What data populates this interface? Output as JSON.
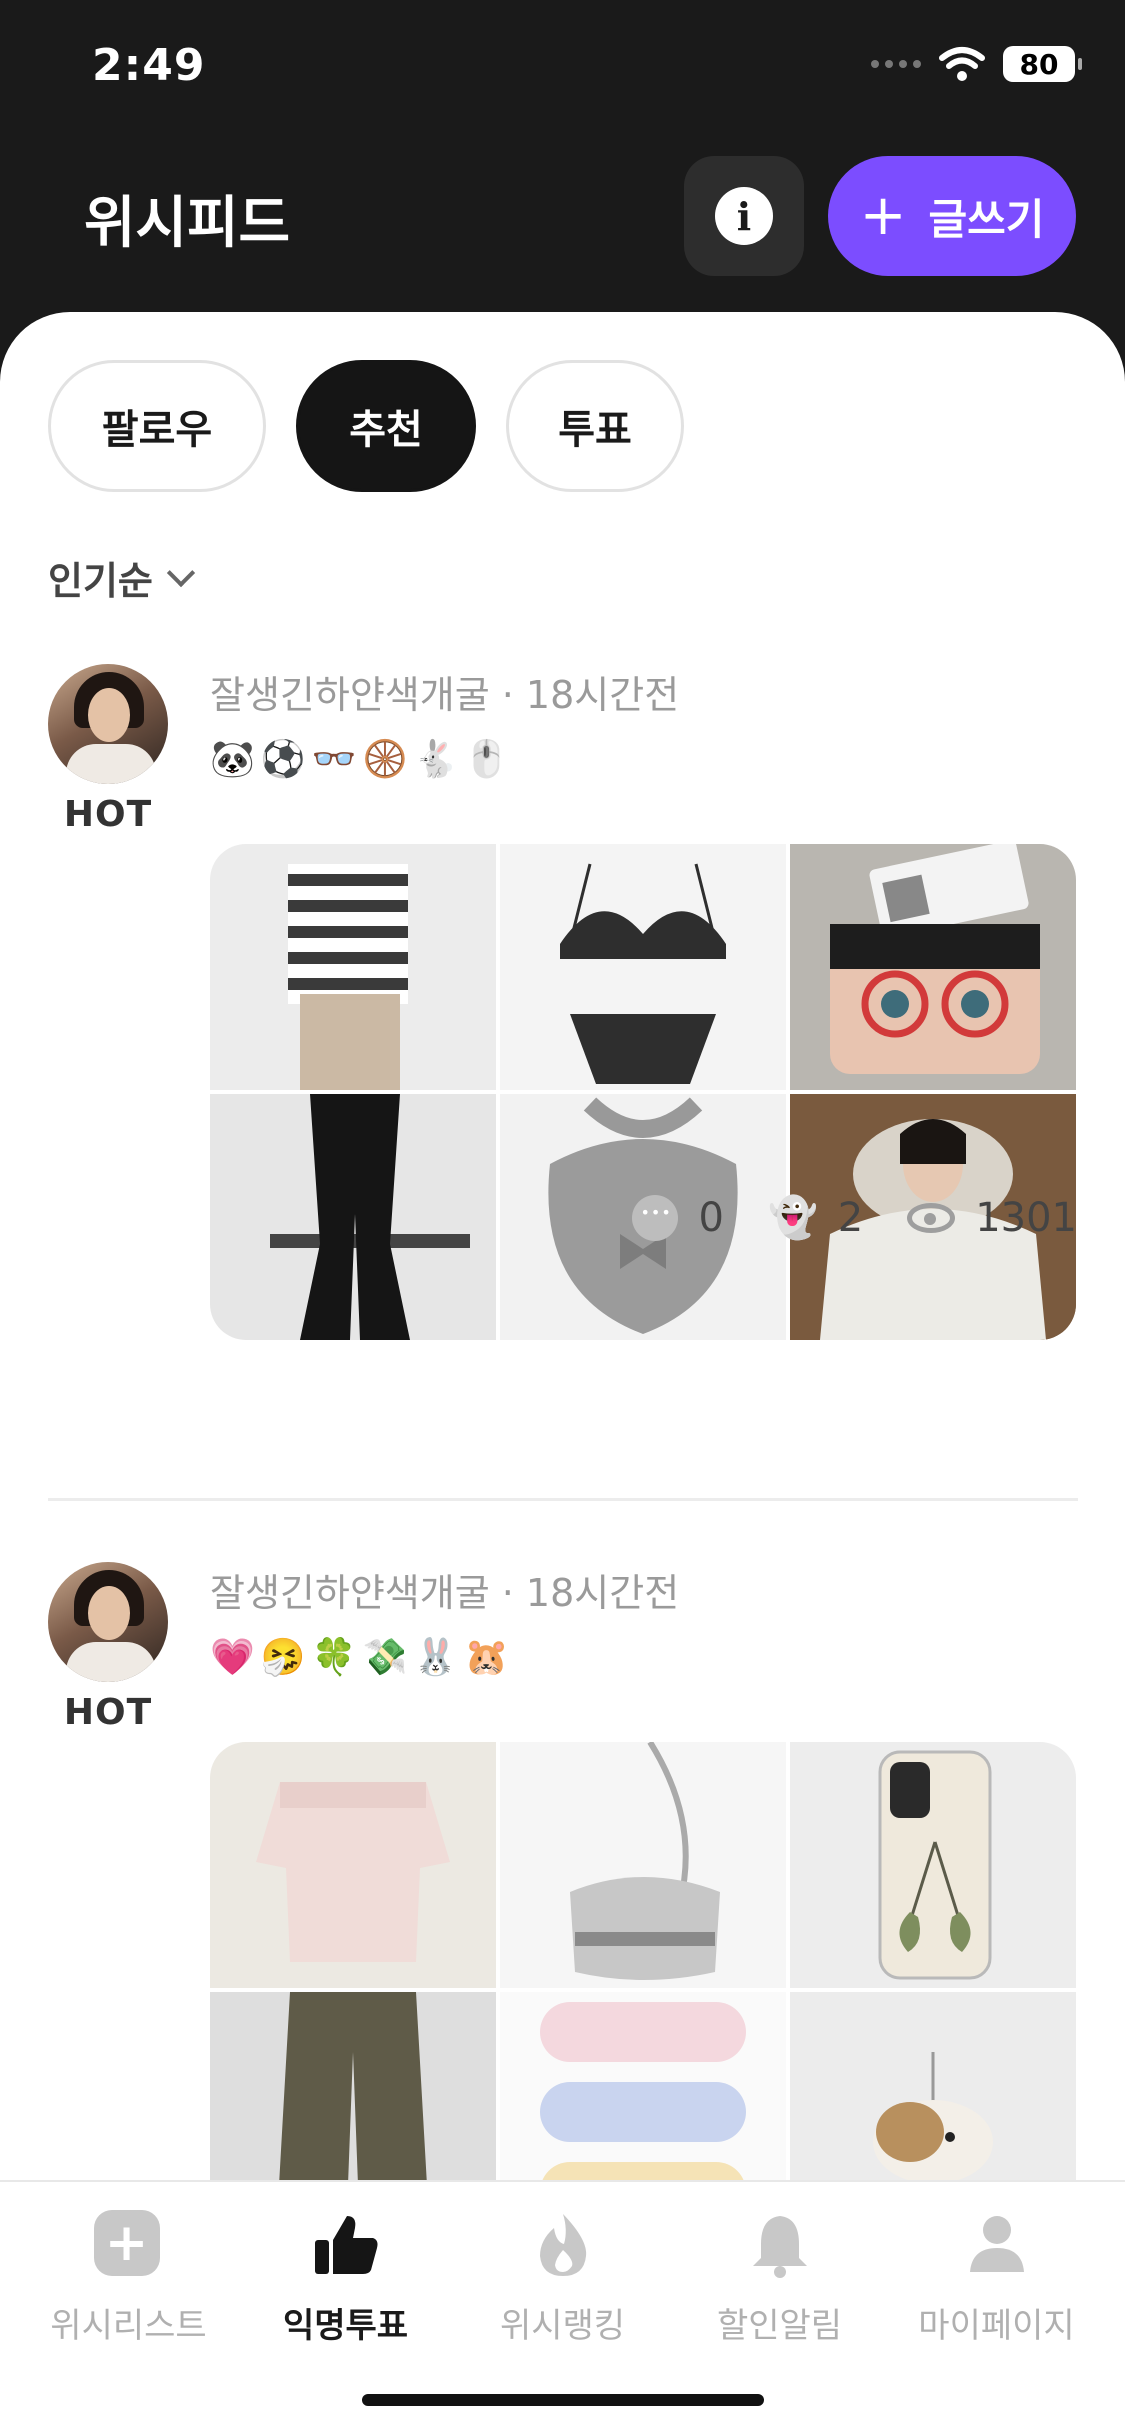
{
  "status_bar": {
    "time": "2:49",
    "battery": "80"
  },
  "header": {
    "title": "위시피드",
    "info_label": "i",
    "write_label": "글쓰기"
  },
  "tabs": [
    {
      "label": "팔로우"
    },
    {
      "label": "추천"
    },
    {
      "label": "투표"
    }
  ],
  "sort": {
    "label": "인기순"
  },
  "posts": [
    {
      "author": "잘생긴하얀색개굴",
      "time": "18시간전",
      "meta": "잘생긴하얀색개굴 · 18시간전",
      "badge": "HOT",
      "emojis": "🐼⚽👓🛞🐇🖱️",
      "stats": {
        "comments": "0",
        "ghosts": "2",
        "views": "1301"
      }
    },
    {
      "author": "잘생긴하얀색개굴",
      "time": "18시간전",
      "meta": "잘생긴하얀색개굴 · 18시간전",
      "badge": "HOT",
      "emojis": "💗🤧🍀💸🐰🐹"
    }
  ],
  "bottom_nav": [
    {
      "label": "위시리스트",
      "icon": "plus-square-icon"
    },
    {
      "label": "익명투표",
      "icon": "thumbs-up-icon",
      "active": true
    },
    {
      "label": "위시랭킹",
      "icon": "fire-icon"
    },
    {
      "label": "할인알림",
      "icon": "bell-icon"
    },
    {
      "label": "마이페이지",
      "icon": "person-icon"
    }
  ]
}
